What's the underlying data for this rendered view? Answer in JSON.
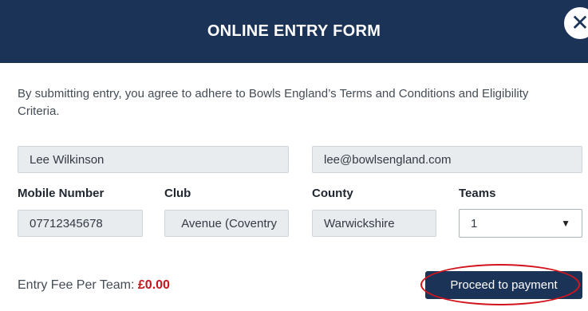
{
  "header": {
    "title": "ONLINE ENTRY FORM",
    "close_icon": "close-icon",
    "close_glyph": "✕"
  },
  "intro_text": "By submitting entry, you agree to adhere to Bowls England’s Terms and Conditions and Eligibility Criteria.",
  "fields": {
    "name": "Lee Wilkinson",
    "email": "lee@bowlsengland.com",
    "mobile": {
      "label": "Mobile Number",
      "value": "07712345678"
    },
    "club": {
      "label": "Club",
      "value": "Avenue (Coventry"
    },
    "county": {
      "label": "County",
      "value": "Warwickshire"
    },
    "teams": {
      "label": "Teams",
      "selected": "1"
    }
  },
  "fee": {
    "label": "Entry Fee Per Team:",
    "amount": "£0.00"
  },
  "actions": {
    "proceed_label": "Proceed to payment"
  },
  "colors": {
    "header_bg": "#1c3358",
    "fee_amount": "#c4161c",
    "highlight_ring": "#d3141c"
  }
}
